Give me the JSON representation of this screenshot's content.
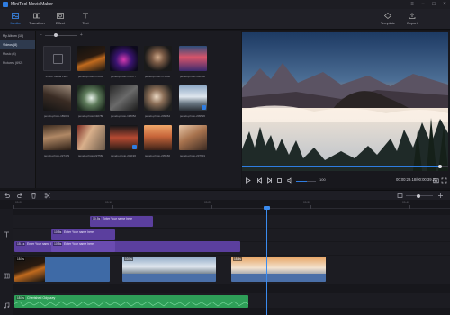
{
  "app": {
    "title": "MiniTool MovieMaker"
  },
  "toolbar": {
    "tabs": [
      {
        "label": "Media",
        "icon": "media-icon",
        "active": true
      },
      {
        "label": "Transition",
        "icon": "transition-icon",
        "active": false
      },
      {
        "label": "Effect",
        "icon": "effect-icon",
        "active": false
      },
      {
        "label": "Text",
        "icon": "text-icon",
        "active": false
      }
    ],
    "template_label": "Template",
    "export_label": "Export"
  },
  "library": {
    "category_header": "My Album (10)",
    "categories": [
      {
        "label": "Videos (8)",
        "selected": true
      },
      {
        "label": "Music (4)",
        "selected": false
      },
      {
        "label": "Pictures (692)",
        "selected": false
      }
    ],
    "import_label": "Import Media Files",
    "media_items": [
      {
        "label": "pexels-photo-170806",
        "checked": false
      },
      {
        "label": "pexels-photo-172677",
        "checked": false
      },
      {
        "label": "pexels-photo-175660",
        "checked": false
      },
      {
        "label": "pexels-photo-182482",
        "checked": false
      },
      {
        "label": "pexels-photo-189001",
        "checked": false
      },
      {
        "label": "pexels-photo-192788",
        "checked": false
      },
      {
        "label": "pexels-photo-198052",
        "checked": false
      },
      {
        "label": "pexels-photo-209064",
        "checked": false
      },
      {
        "label": "pexels-photo-209520",
        "checked": true
      },
      {
        "label": "pexels-photo-227429",
        "checked": false
      },
      {
        "label": "pexels-photo-227560",
        "checked": false
      },
      {
        "label": "pexels-photo-231196",
        "checked": true
      },
      {
        "label": "pexels-photo-235166",
        "checked": false
      },
      {
        "label": "pexels-photo-237631",
        "checked": false
      }
    ]
  },
  "preview": {
    "progress": 0.96,
    "volume": 100,
    "volume_fraction": 0.55,
    "timecode": "00:00:29.18/00:00:39.23"
  },
  "timeline": {
    "ruler_labels": [
      "00:00",
      "00:10",
      "00:20",
      "00:30",
      "00:40"
    ],
    "text_clips": [
      {
        "duration": "10.5s",
        "text": "Enter Your name here"
      },
      {
        "duration": "10.5s",
        "text": "Enter Your name here"
      },
      {
        "duration": "15.1s",
        "text": "Enter Your name here"
      },
      {
        "duration": "10.5s",
        "text": "Enter Your name here"
      }
    ],
    "video_clips": [
      {
        "duration": "15.5s"
      },
      {
        "duration": "10.5s"
      },
      {
        "duration": "15.5s"
      }
    ],
    "audio_clip": {
      "duration": "15.5s",
      "name": "Cherished Odyssey"
    }
  },
  "colors": {
    "accent": "#2f7de1",
    "text_clip": "#5b3f9e",
    "audio_clip": "#2e9f58",
    "playhead": "#3b8cf0"
  }
}
